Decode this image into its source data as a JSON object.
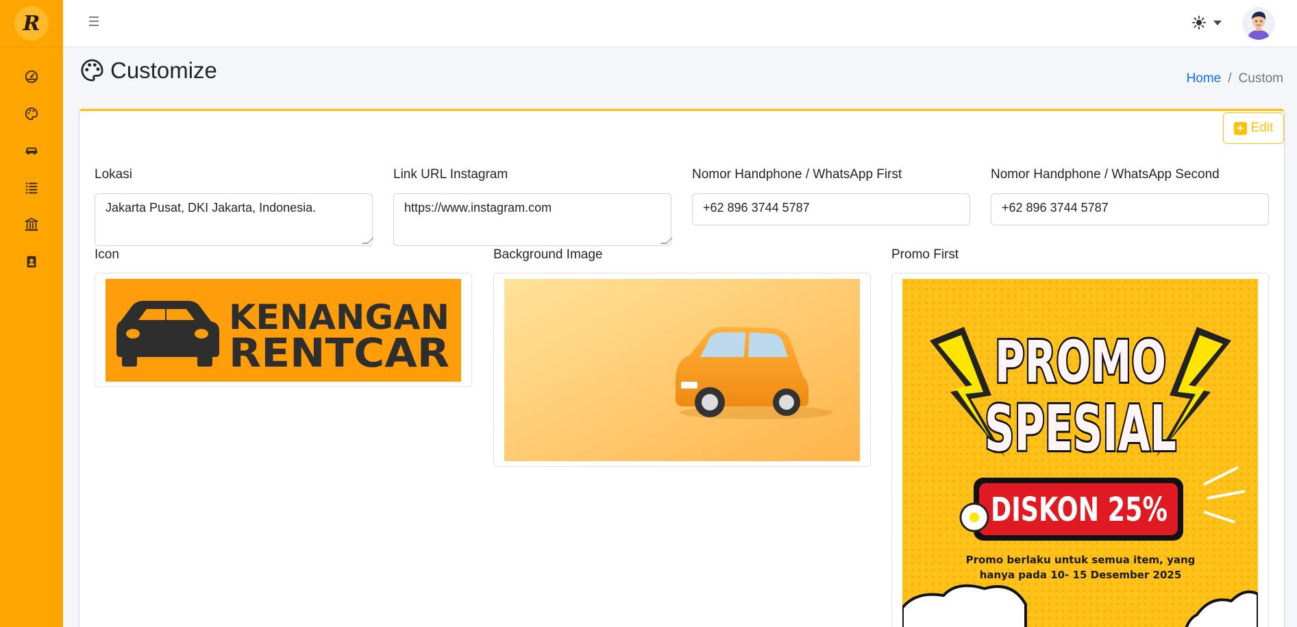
{
  "sidebar": {
    "brand_letter": "R",
    "items": [
      {
        "icon": "dashboard-gauge-icon"
      },
      {
        "icon": "palette-icon"
      },
      {
        "icon": "car-icon"
      },
      {
        "icon": "list-icon"
      },
      {
        "icon": "bank-icon"
      },
      {
        "icon": "contact-book-icon"
      }
    ]
  },
  "header": {
    "theme_icon": "sun-icon",
    "avatar_icon": "user-avatar"
  },
  "page": {
    "title": "Customize",
    "breadcrumb": {
      "home": "Home",
      "separator": "/",
      "current": "Custom"
    }
  },
  "card": {
    "edit_label": "Edit"
  },
  "form": {
    "lokasi": {
      "label": "Lokasi",
      "value": "Jakarta Pusat, DKI Jakarta, Indonesia."
    },
    "instagram": {
      "label": "Link URL Instagram",
      "value": "https://www.instagram.com"
    },
    "phone_first": {
      "label": "Nomor Handphone / WhatsApp First",
      "value": "+62 896 3744 5787"
    },
    "phone_second": {
      "label": "Nomor Handphone / WhatsApp Second",
      "value": "+62 896 3744 5787"
    },
    "icon": {
      "label": "Icon",
      "text_line1": "KENANGAN",
      "text_line2": "RENTCAR"
    },
    "background": {
      "label": "Background Image"
    },
    "promo_first": {
      "label": "Promo First",
      "title_line1": "PROMO",
      "title_line2": "SPESIAL",
      "discount": "DISKON 25%",
      "desc_line1": "Promo berlaku untuk semua item, yang",
      "desc_line2": "hanya pada 10- 15 Desember 2025"
    }
  },
  "colors": {
    "accent": "#ffa500",
    "warning": "#ffc107",
    "link": "#0d6efd"
  }
}
